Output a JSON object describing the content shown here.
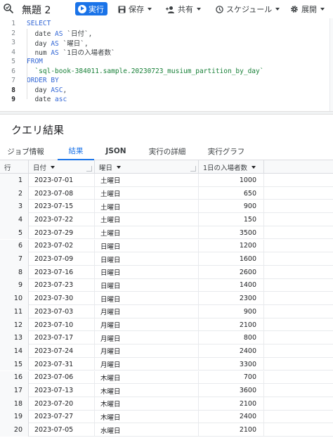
{
  "toolbar": {
    "title": "無題 2",
    "run_label": "実行",
    "save_label": "保存",
    "share_label": "共有",
    "schedule_label": "スケジュール",
    "expand_label": "展開"
  },
  "editor": {
    "lines": [
      {
        "num": "1",
        "tokens": [
          {
            "t": "SELECT",
            "c": "kw"
          }
        ]
      },
      {
        "num": "2",
        "tokens": [
          {
            "t": "  date ",
            "c": ""
          },
          {
            "t": "AS",
            "c": "kw"
          },
          {
            "t": " `日付`,",
            "c": ""
          }
        ]
      },
      {
        "num": "3",
        "tokens": [
          {
            "t": "  day ",
            "c": ""
          },
          {
            "t": "AS",
            "c": "kw"
          },
          {
            "t": " `曜日`,",
            "c": ""
          }
        ]
      },
      {
        "num": "4",
        "tokens": [
          {
            "t": "  num ",
            "c": ""
          },
          {
            "t": "AS",
            "c": "kw"
          },
          {
            "t": " `1日の入場者数`",
            "c": ""
          }
        ]
      },
      {
        "num": "5",
        "tokens": [
          {
            "t": "FROM",
            "c": "kw"
          }
        ]
      },
      {
        "num": "6",
        "tokens": [
          {
            "t": "  `sql-book-384011.sample.20230723_musium_partition_by_day`",
            "c": "str"
          }
        ]
      },
      {
        "num": "7",
        "tokens": [
          {
            "t": "ORDER BY",
            "c": "kw"
          }
        ]
      },
      {
        "num": "8",
        "tokens": [
          {
            "t": "  day ",
            "c": ""
          },
          {
            "t": "ASC",
            "c": "kw"
          },
          {
            "t": ",",
            "c": ""
          }
        ]
      },
      {
        "num": "9",
        "tokens": [
          {
            "t": "  date ",
            "c": ""
          },
          {
            "t": "asc",
            "c": "kw"
          }
        ]
      }
    ]
  },
  "results": {
    "title": "クエリ結果",
    "tabs": [
      "ジョブ情報",
      "結果",
      "JSON",
      "実行の詳細",
      "実行グラフ"
    ],
    "active_tab": "結果",
    "columns": [
      "行",
      "日付",
      "曜日",
      "1日の入場者数"
    ],
    "rows": [
      [
        "1",
        "2023-07-01",
        "土曜日",
        "1000"
      ],
      [
        "2",
        "2023-07-08",
        "土曜日",
        "650"
      ],
      [
        "3",
        "2023-07-15",
        "土曜日",
        "900"
      ],
      [
        "4",
        "2023-07-22",
        "土曜日",
        "150"
      ],
      [
        "5",
        "2023-07-29",
        "土曜日",
        "3500"
      ],
      [
        "6",
        "2023-07-02",
        "日曜日",
        "1200"
      ],
      [
        "7",
        "2023-07-09",
        "日曜日",
        "1600"
      ],
      [
        "8",
        "2023-07-16",
        "日曜日",
        "2600"
      ],
      [
        "9",
        "2023-07-23",
        "日曜日",
        "1400"
      ],
      [
        "10",
        "2023-07-30",
        "日曜日",
        "2300"
      ],
      [
        "11",
        "2023-07-03",
        "月曜日",
        "900"
      ],
      [
        "12",
        "2023-07-10",
        "月曜日",
        "2100"
      ],
      [
        "13",
        "2023-07-17",
        "月曜日",
        "800"
      ],
      [
        "14",
        "2023-07-24",
        "月曜日",
        "2400"
      ],
      [
        "15",
        "2023-07-31",
        "月曜日",
        "3300"
      ],
      [
        "16",
        "2023-07-06",
        "木曜日",
        "700"
      ],
      [
        "17",
        "2023-07-13",
        "木曜日",
        "3600"
      ],
      [
        "18",
        "2023-07-20",
        "木曜日",
        "2100"
      ],
      [
        "19",
        "2023-07-27",
        "木曜日",
        "2400"
      ],
      [
        "20",
        "2023-07-05",
        "水曜日",
        "2100"
      ]
    ]
  },
  "colors": {
    "accent": "#1a73e8",
    "keyword": "#3367d6",
    "string": "#188038"
  },
  "icons": [
    "query-icon",
    "play-icon",
    "save-icon",
    "share-icon",
    "schedule-icon",
    "gear-icon"
  ]
}
